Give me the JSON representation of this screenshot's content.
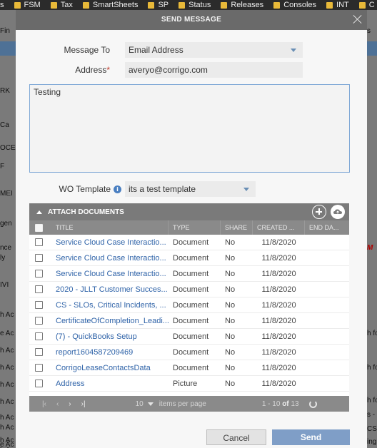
{
  "bookmarks": [
    "s",
    "FSM",
    "Tax",
    "SmartSheets",
    "SP",
    "Status",
    "Releases",
    "Consoles",
    "INT",
    "C"
  ],
  "background": {
    "left_fragments": [
      "Fin",
      "RK",
      "Ca",
      "OCE",
      "F",
      "MEI",
      "gen",
      "nce",
      "ly",
      "IVI",
      "h Ac",
      "e Ac",
      "h Ac",
      "h Ac",
      "h Ac",
      "h Ac",
      "h Ac",
      "h Ac",
      "h Ac",
      "e Ac",
      "h Ac"
    ],
    "right_fragments": [
      "s",
      "M",
      "h fo",
      "h fo",
      "h fo",
      "s -",
      "CS:",
      "ing"
    ]
  },
  "modal": {
    "title": "SEND MESSAGE",
    "message_to_label": "Message To",
    "message_to_value": "Email Address",
    "address_label": "Address",
    "address_required_mark": "*",
    "address_value": "averyo@corrigo.com",
    "body_text": "Testing",
    "wo_template_label": "WO Template",
    "wo_template_info_icon": "i",
    "wo_template_value": "its a test template",
    "cancel_label": "Cancel",
    "send_label": "Send"
  },
  "attach_documents": {
    "header": "ATTACH DOCUMENTS",
    "columns": {
      "title": "TITLE",
      "type": "TYPE",
      "share": "SHARE",
      "created": "CREATED ...",
      "end": "END DA..."
    },
    "rows": [
      {
        "title": "Service Cloud Case Interactio...",
        "type": "Document",
        "share": "No",
        "created": "11/8/2020"
      },
      {
        "title": "Service Cloud Case Interactio...",
        "type": "Document",
        "share": "No",
        "created": "11/8/2020"
      },
      {
        "title": "Service Cloud Case Interactio...",
        "type": "Document",
        "share": "No",
        "created": "11/8/2020"
      },
      {
        "title": "2020 - JLLT Customer Succes...",
        "type": "Document",
        "share": "No",
        "created": "11/8/2020"
      },
      {
        "title": "CS - SLOs, Critical Incidents, ...",
        "type": "Document",
        "share": "No",
        "created": "11/8/2020"
      },
      {
        "title": "CertificateOfCompletion_Leadi...",
        "type": "Document",
        "share": "No",
        "created": "11/8/2020"
      },
      {
        "title": "(7) - QuickBooks Setup",
        "type": "Document",
        "share": "No",
        "created": "11/8/2020"
      },
      {
        "title": "report1604587209469",
        "type": "Document",
        "share": "No",
        "created": "11/8/2020"
      },
      {
        "title": "CorrigoLeaseContactsData",
        "type": "Document",
        "share": "No",
        "created": "11/8/2020"
      },
      {
        "title": "Address",
        "type": "Picture",
        "share": "No",
        "created": "11/8/2020"
      }
    ],
    "pager": {
      "page_size": "10",
      "items_per_page": "items per page",
      "range": "1 - 10",
      "of": "of",
      "total": "13"
    }
  },
  "colors": {
    "header_bg": "#6a6a6a",
    "link": "#2f63a8",
    "send_button": "#7f9ec7",
    "required": "#c0392b"
  }
}
